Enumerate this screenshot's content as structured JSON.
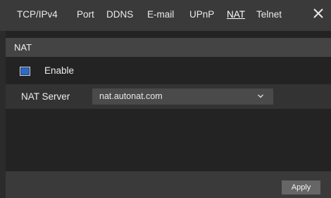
{
  "tabs": [
    {
      "label": "TCP/IPv4"
    },
    {
      "label": "Port"
    },
    {
      "label": "DDNS"
    },
    {
      "label": "E-mail"
    },
    {
      "label": "UPnP"
    },
    {
      "label": "NAT",
      "active": true
    },
    {
      "label": "Telnet"
    }
  ],
  "icons": {
    "close": "close-icon",
    "dropdown": "chevron-down-icon",
    "checkbox": "checkbox-checked"
  },
  "section": {
    "title": "NAT"
  },
  "enable": {
    "label": "Enable",
    "checked": true
  },
  "nat_server": {
    "label": "NAT Server",
    "value": "nat.autonat.com"
  },
  "footer": {
    "apply_label": "Apply"
  },
  "colors": {
    "accent": "#2f6bc4"
  }
}
